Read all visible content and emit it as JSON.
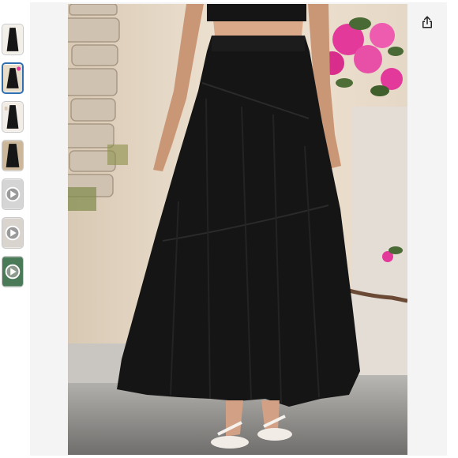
{
  "gallery": {
    "selected_index": 1,
    "thumbnails": [
      {
        "kind": "image",
        "icon": "skirt-photo"
      },
      {
        "kind": "image",
        "icon": "skirt-photo"
      },
      {
        "kind": "image",
        "icon": "skirt-photo"
      },
      {
        "kind": "image",
        "icon": "skirt-photo"
      },
      {
        "kind": "video",
        "icon": "play-icon"
      },
      {
        "kind": "video",
        "icon": "play-icon"
      },
      {
        "kind": "video",
        "icon": "play-icon"
      }
    ]
  },
  "main_image": {
    "subject": "black-tiered-maxi-skirt",
    "colors": {
      "skirt": "#151515",
      "wall": "#e9dcc9",
      "flowers": "#e3399a",
      "ground": "#8b8b8b"
    }
  },
  "toolbar": {
    "share_icon": "share-icon"
  }
}
